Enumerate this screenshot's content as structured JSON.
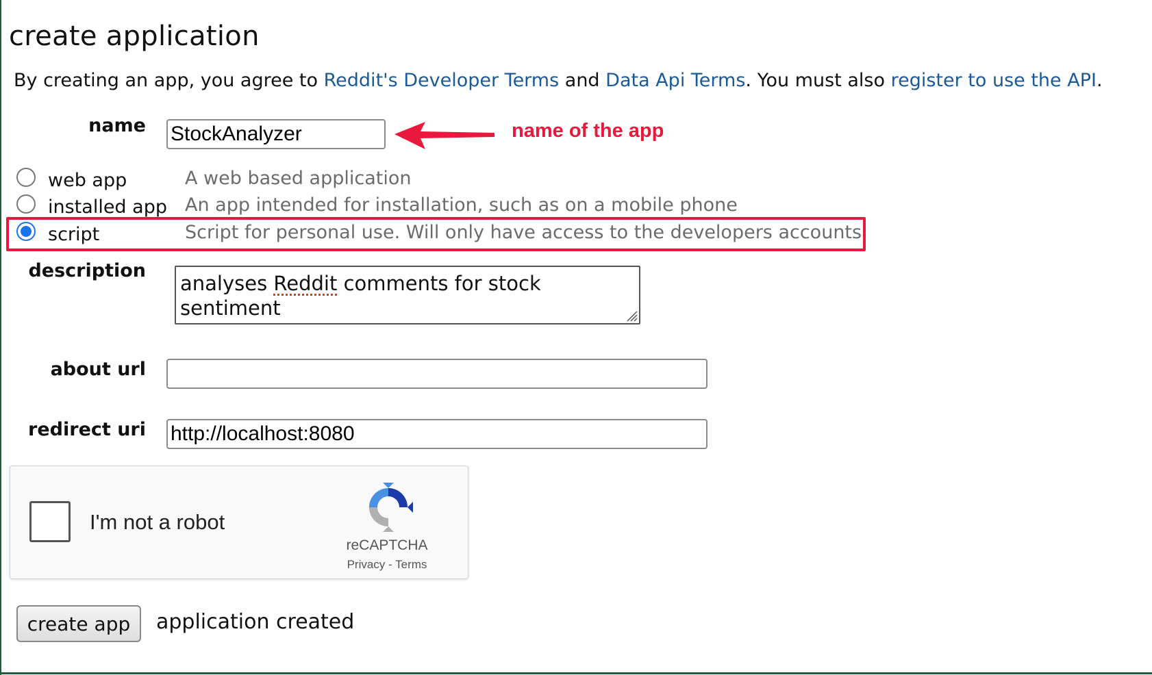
{
  "page": {
    "title": "create application",
    "intro": {
      "text_1": "By creating an app, you agree to ",
      "link_developer_terms": "Reddit's Developer Terms",
      "text_2": " and ",
      "link_data_api_terms": "Data Api Terms",
      "text_3": ". You must also ",
      "link_register_api": "register to use the API",
      "text_4": "."
    }
  },
  "form": {
    "name": {
      "label": "name",
      "value": "StockAnalyzer"
    },
    "app_types": [
      {
        "label": "web app",
        "description": "A web based application",
        "selected": false
      },
      {
        "label": "installed app",
        "description": "An app intended for installation, such as on a mobile phone",
        "selected": false
      },
      {
        "label": "script",
        "description": "Script for personal use. Will only have access to the developers accounts",
        "selected": true
      }
    ],
    "description": {
      "label": "description",
      "value_line1_a": "analyses ",
      "value_line1_b": "Reddit",
      "value_line1_c": " comments for stock",
      "value_line2": "sentiment"
    },
    "about_url": {
      "label": "about url",
      "value": ""
    },
    "redirect_uri": {
      "label": "redirect uri",
      "value": "http://localhost:8080"
    }
  },
  "annotation": {
    "text": "name of the app",
    "color": "#e8193c"
  },
  "captcha": {
    "label": "I'm not a robot",
    "brand": "reCAPTCHA",
    "privacy": "Privacy",
    "separator": " - ",
    "terms": "Terms"
  },
  "actions": {
    "create_button": "create app",
    "status": "application created"
  },
  "colors": {
    "link": "#1a5a99",
    "radio_selected": "#1a73e8",
    "frame": "#1e5c3a"
  }
}
